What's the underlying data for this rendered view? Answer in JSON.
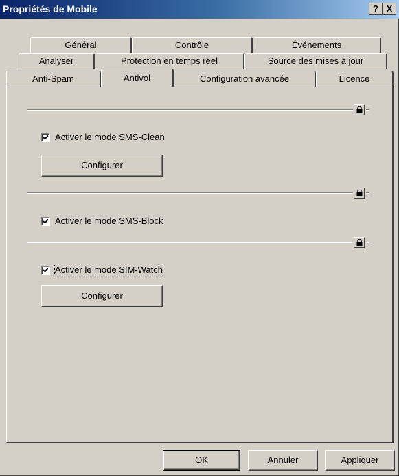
{
  "window": {
    "title": "Propriétés de Mobile",
    "help_label": "?",
    "close_label": "X"
  },
  "tabs": {
    "row1": [
      "Général",
      "Contrôle",
      "Événements"
    ],
    "row2": [
      "Analyser",
      "Protection en temps réel",
      "Source des mises à jour"
    ],
    "row3": [
      "Anti-Spam",
      "Antivol",
      "Configuration avancée",
      "Licence"
    ],
    "active": "Antivol"
  },
  "sections": [
    {
      "checkbox_label": "Activer le mode SMS-Clean",
      "checked": true,
      "button_label": "Configurer"
    },
    {
      "checkbox_label": "Activer le mode SMS-Block",
      "checked": true
    },
    {
      "checkbox_label": "Activer le mode SIM-Watch",
      "checked": true,
      "button_label": "Configurer"
    }
  ],
  "footer": {
    "ok_label": "OK",
    "cancel_label": "Annuler",
    "apply_label": "Appliquer"
  },
  "icons": {
    "lock": "padlock-icon",
    "check": "checkmark-icon"
  }
}
